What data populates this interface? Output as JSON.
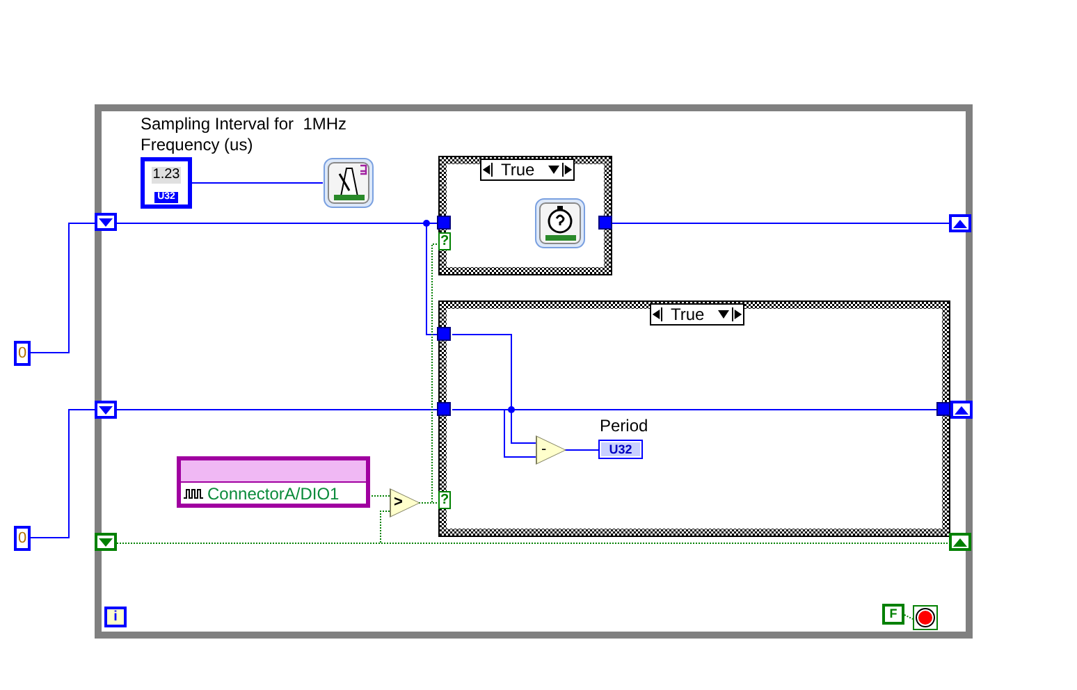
{
  "control": {
    "label": "Sampling Interval for  1MHz Frequency (us)",
    "value": "1.23",
    "type": "U32"
  },
  "constants": [
    "0",
    "0"
  ],
  "case_structures": [
    {
      "selector": "True",
      "condition": "?"
    },
    {
      "selector": "True",
      "condition": "?"
    }
  ],
  "daq_channel": "ConnectorA/DIO1",
  "compare": ">",
  "subtract": "-",
  "indicator": {
    "label": "Period",
    "type": "U32"
  },
  "while_loop": {
    "iteration_terminal": "i",
    "stop_constant": "F"
  }
}
